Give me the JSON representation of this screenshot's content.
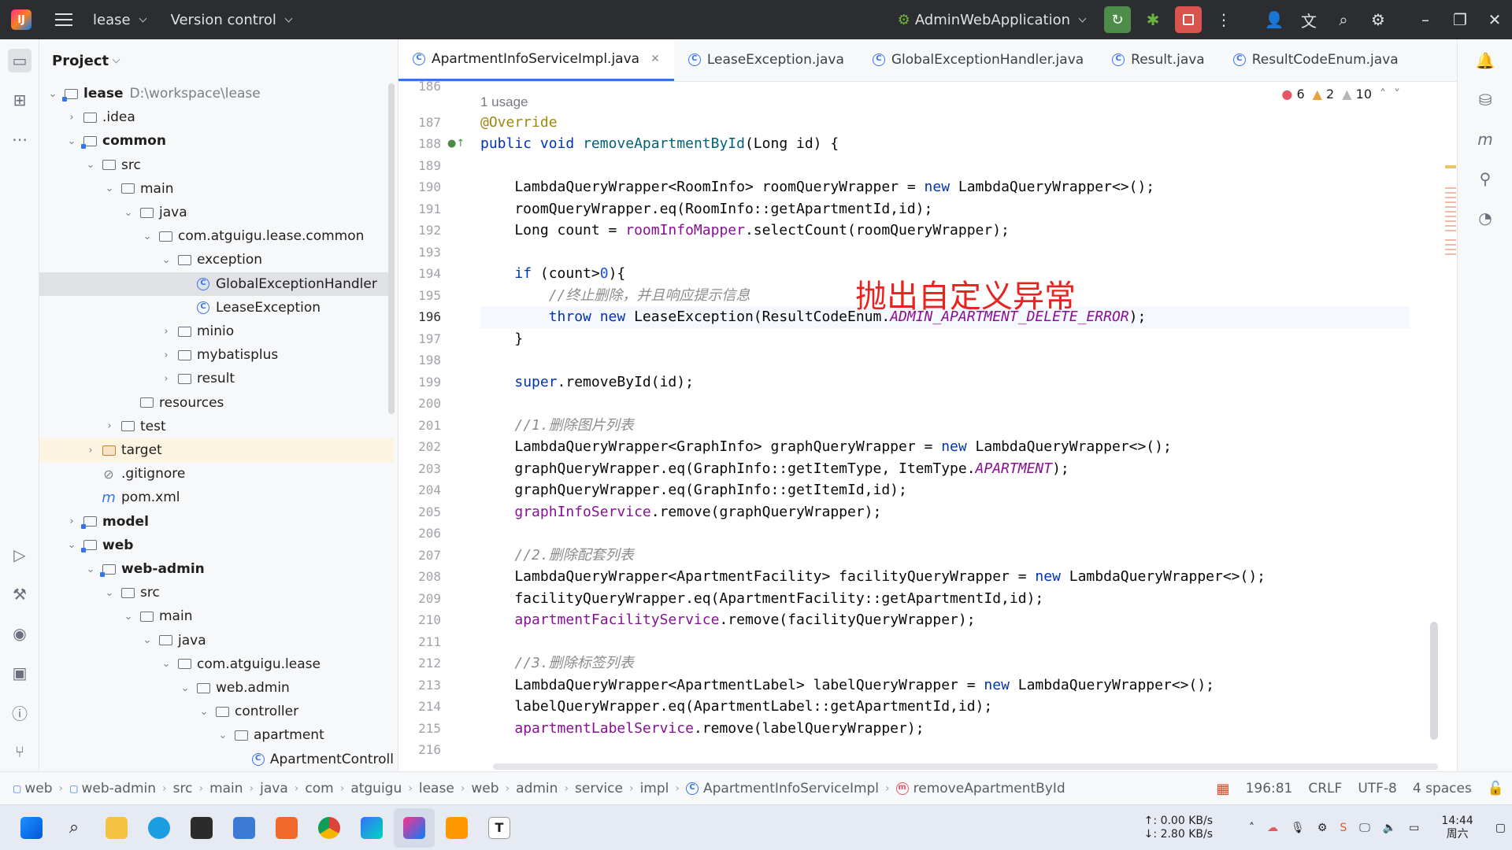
{
  "titlebar": {
    "project_name": "lease",
    "vcs": "Version control",
    "run_config": "AdminWebApplication"
  },
  "project_panel": {
    "title": "Project",
    "tree": [
      {
        "label": "lease",
        "path": "D:\\workspace\\lease",
        "depth": 0,
        "expanded": true,
        "type": "module",
        "bold": true
      },
      {
        "label": ".idea",
        "depth": 1,
        "expanded": false,
        "type": "folder"
      },
      {
        "label": "common",
        "depth": 1,
        "expanded": true,
        "type": "module",
        "bold": true
      },
      {
        "label": "src",
        "depth": 2,
        "expanded": true,
        "type": "folder"
      },
      {
        "label": "main",
        "depth": 3,
        "expanded": true,
        "type": "folder"
      },
      {
        "label": "java",
        "depth": 4,
        "expanded": true,
        "type": "folder"
      },
      {
        "label": "com.atguigu.lease.common",
        "depth": 5,
        "expanded": true,
        "type": "package"
      },
      {
        "label": "exception",
        "depth": 6,
        "expanded": true,
        "type": "package"
      },
      {
        "label": "GlobalExceptionHandler",
        "depth": 7,
        "type": "class",
        "selected": true
      },
      {
        "label": "LeaseException",
        "depth": 7,
        "type": "class"
      },
      {
        "label": "minio",
        "depth": 6,
        "expanded": false,
        "type": "package"
      },
      {
        "label": "mybatisplus",
        "depth": 6,
        "expanded": false,
        "type": "package"
      },
      {
        "label": "result",
        "depth": 6,
        "expanded": false,
        "type": "package"
      },
      {
        "label": "resources",
        "depth": 4,
        "type": "folder"
      },
      {
        "label": "test",
        "depth": 3,
        "expanded": false,
        "type": "folder"
      },
      {
        "label": "target",
        "depth": 2,
        "expanded": false,
        "type": "target"
      },
      {
        "label": ".gitignore",
        "depth": 2,
        "type": "file"
      },
      {
        "label": "pom.xml",
        "depth": 2,
        "type": "maven"
      },
      {
        "label": "model",
        "depth": 1,
        "expanded": false,
        "type": "module",
        "bold": true
      },
      {
        "label": "web",
        "depth": 1,
        "expanded": true,
        "type": "module",
        "bold": true
      },
      {
        "label": "web-admin",
        "depth": 2,
        "expanded": true,
        "type": "module",
        "bold": true
      },
      {
        "label": "src",
        "depth": 3,
        "expanded": true,
        "type": "folder"
      },
      {
        "label": "main",
        "depth": 4,
        "expanded": true,
        "type": "folder"
      },
      {
        "label": "java",
        "depth": 5,
        "expanded": true,
        "type": "folder"
      },
      {
        "label": "com.atguigu.lease",
        "depth": 6,
        "expanded": true,
        "type": "package"
      },
      {
        "label": "web.admin",
        "depth": 7,
        "expanded": true,
        "type": "package"
      },
      {
        "label": "controller",
        "depth": 8,
        "expanded": true,
        "type": "package"
      },
      {
        "label": "apartment",
        "depth": 9,
        "expanded": true,
        "type": "package"
      },
      {
        "label": "ApartmentControll",
        "depth": 10,
        "type": "class"
      }
    ]
  },
  "tabs": [
    {
      "label": "ApartmentInfoServiceImpl.java",
      "active": true
    },
    {
      "label": "LeaseException.java",
      "active": false
    },
    {
      "label": "GlobalExceptionHandler.java",
      "active": false
    },
    {
      "label": "Result.java",
      "active": false
    },
    {
      "label": "ResultCodeEnum.java",
      "active": false
    }
  ],
  "inspections": {
    "errors": "6",
    "warnings": "2",
    "weak": "10"
  },
  "code": {
    "first_line_partial": "186",
    "usage_hint": "1 usage",
    "current_line": "196",
    "lines": [
      {
        "n": "187",
        "html": "<span class=\"ann\">@Override</span>"
      },
      {
        "n": "188",
        "html": "<span class=\"kw\">public void</span> <span class=\"fn\">removeApartmentById</span>(Long id) {"
      },
      {
        "n": "189",
        "html": ""
      },
      {
        "n": "190",
        "html": "    LambdaQueryWrapper&lt;RoomInfo&gt; roomQueryWrapper = <span class=\"kw\">new</span> LambdaQueryWrapper&lt;&gt;();"
      },
      {
        "n": "191",
        "html": "    roomQueryWrapper.eq(RoomInfo::getApartmentId,id);"
      },
      {
        "n": "192",
        "html": "    Long count = <span class=\"fld\">roomInfoMapper</span>.selectCount(roomQueryWrapper);"
      },
      {
        "n": "193",
        "html": ""
      },
      {
        "n": "194",
        "html": "    <span class=\"kw\">if</span> (count&gt;<span class=\"num\">0</span>){"
      },
      {
        "n": "195",
        "html": "        <span class=\"cmt\">//终止删除，并且响应提示信息</span>"
      },
      {
        "n": "196",
        "html": "        <span class=\"kw\">throw new</span> LeaseException(ResultCodeEnum.<span class=\"enm\">ADMIN_APARTMENT_DELETE_ERROR</span>);"
      },
      {
        "n": "197",
        "html": "    }"
      },
      {
        "n": "198",
        "html": ""
      },
      {
        "n": "199",
        "html": "    <span class=\"kw\">super</span>.removeById(id);"
      },
      {
        "n": "200",
        "html": ""
      },
      {
        "n": "201",
        "html": "    <span class=\"cmt\">//1.删除图片列表</span>"
      },
      {
        "n": "202",
        "html": "    LambdaQueryWrapper&lt;GraphInfo&gt; graphQueryWrapper = <span class=\"kw\">new</span> LambdaQueryWrapper&lt;&gt;();"
      },
      {
        "n": "203",
        "html": "    graphQueryWrapper.eq(GraphInfo::getItemType, ItemType.<span class=\"enm\">APARTMENT</span>);"
      },
      {
        "n": "204",
        "html": "    graphQueryWrapper.eq(GraphInfo::getItemId,id);"
      },
      {
        "n": "205",
        "html": "    <span class=\"fld\">graphInfoService</span>.remove(graphQueryWrapper);"
      },
      {
        "n": "206",
        "html": ""
      },
      {
        "n": "207",
        "html": "    <span class=\"cmt\">//2.删除配套列表</span>"
      },
      {
        "n": "208",
        "html": "    LambdaQueryWrapper&lt;ApartmentFacility&gt; facilityQueryWrapper = <span class=\"kw\">new</span> LambdaQueryWrapper&lt;&gt;();"
      },
      {
        "n": "209",
        "html": "    facilityQueryWrapper.eq(ApartmentFacility::getApartmentId,id);"
      },
      {
        "n": "210",
        "html": "    <span class=\"fld\">apartmentFacilityService</span>.remove(facilityQueryWrapper);"
      },
      {
        "n": "211",
        "html": ""
      },
      {
        "n": "212",
        "html": "    <span class=\"cmt\">//3.删除标签列表</span>"
      },
      {
        "n": "213",
        "html": "    LambdaQueryWrapper&lt;ApartmentLabel&gt; labelQueryWrapper = <span class=\"kw\">new</span> LambdaQueryWrapper&lt;&gt;();"
      },
      {
        "n": "214",
        "html": "    labelQueryWrapper.eq(ApartmentLabel::getApartmentId,id);"
      },
      {
        "n": "215",
        "html": "    <span class=\"fld\">apartmentLabelService</span>.remove(labelQueryWrapper);"
      },
      {
        "n": "216",
        "html": ""
      }
    ]
  },
  "overlay_annotation": "抛出自定义异常",
  "breadcrumb": [
    "web",
    "web-admin",
    "src",
    "main",
    "java",
    "com",
    "atguigu",
    "lease",
    "web",
    "admin",
    "service",
    "impl",
    "ApartmentInfoServiceImpl",
    "removeApartmentById"
  ],
  "status": {
    "position": "196:81",
    "line_sep": "CRLF",
    "encoding": "UTF-8",
    "indent": "4 spaces"
  },
  "taskbar": {
    "net_up": "↑: 0.00 KB/s",
    "net_down": "↓: 2.80 KB/s",
    "time": "14:44",
    "day": "周六"
  }
}
